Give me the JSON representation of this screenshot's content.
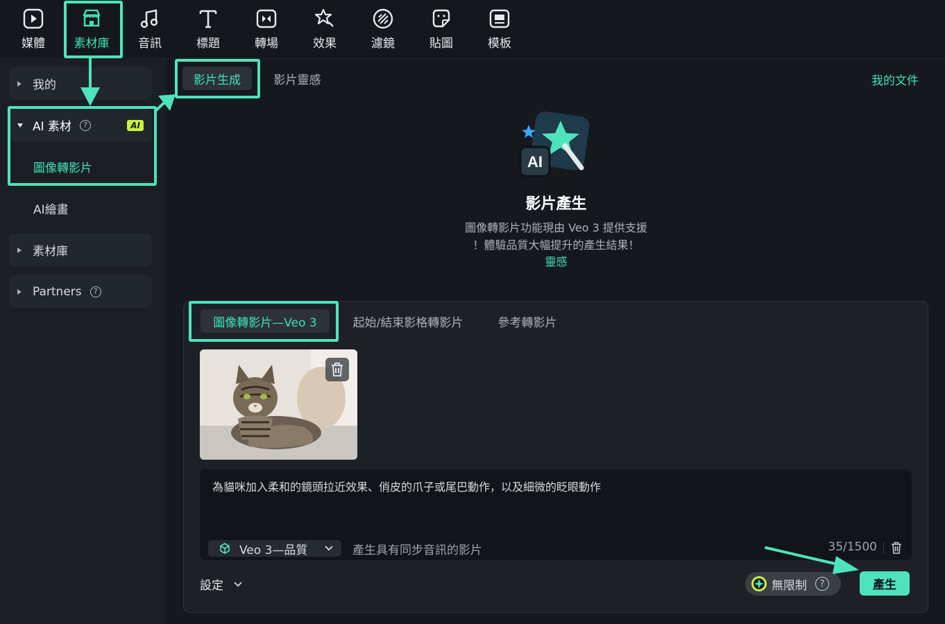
{
  "toolbar": {
    "items": [
      {
        "label": "媒體",
        "icon": "media-icon"
      },
      {
        "label": "素材庫",
        "icon": "store-icon"
      },
      {
        "label": "音訊",
        "icon": "music-note-icon"
      },
      {
        "label": "標題",
        "icon": "text-icon"
      },
      {
        "label": "轉場",
        "icon": "transition-icon"
      },
      {
        "label": "效果",
        "icon": "effects-icon"
      },
      {
        "label": "濾鏡",
        "icon": "filter-icon"
      },
      {
        "label": "貼圖",
        "icon": "sticker-icon"
      },
      {
        "label": "模板",
        "icon": "template-icon"
      }
    ],
    "active": "素材庫"
  },
  "sidebar": {
    "mine": "我的",
    "ai_assets": "AI 素材",
    "ai_badge": "AI",
    "image_to_video": "圖像轉影片",
    "ai_paint": "AI繪畫",
    "asset_library": "素材庫",
    "partners": "Partners",
    "help_glyph": "?"
  },
  "main": {
    "tabs": [
      {
        "label": "影片生成",
        "active": true
      },
      {
        "label": "影片靈感",
        "active": false
      }
    ],
    "my_docs": "我的文件",
    "hero": {
      "title": "影片產生",
      "desc_line1": "圖像轉影片功能現由 Veo 3 提供支援",
      "desc_line2": "！體驗品質大幅提升的產生結果！",
      "link": "靈感"
    },
    "panel": {
      "subtabs": [
        {
          "label": "圖像轉影片—Veo 3",
          "active": true
        },
        {
          "label": "起始/結束影格轉影片",
          "active": false
        },
        {
          "label": "參考轉影片",
          "active": false
        }
      ],
      "prompt": "為貓咪加入柔和的鏡頭拉近效果、俏皮的爪子或尾巴動作，以及細微的眨眼動作",
      "model": "Veo 3—品質",
      "audio_option": "產生具有同步音訊的影片",
      "counter": "35/1500",
      "settings": "設定",
      "unlimited": "無限制",
      "generate": "產生"
    }
  },
  "colors": {
    "accent": "#4fe3bd",
    "background": "#15191e",
    "sidebar": "#1b1f25",
    "ai_badge": "#c8f53a"
  }
}
